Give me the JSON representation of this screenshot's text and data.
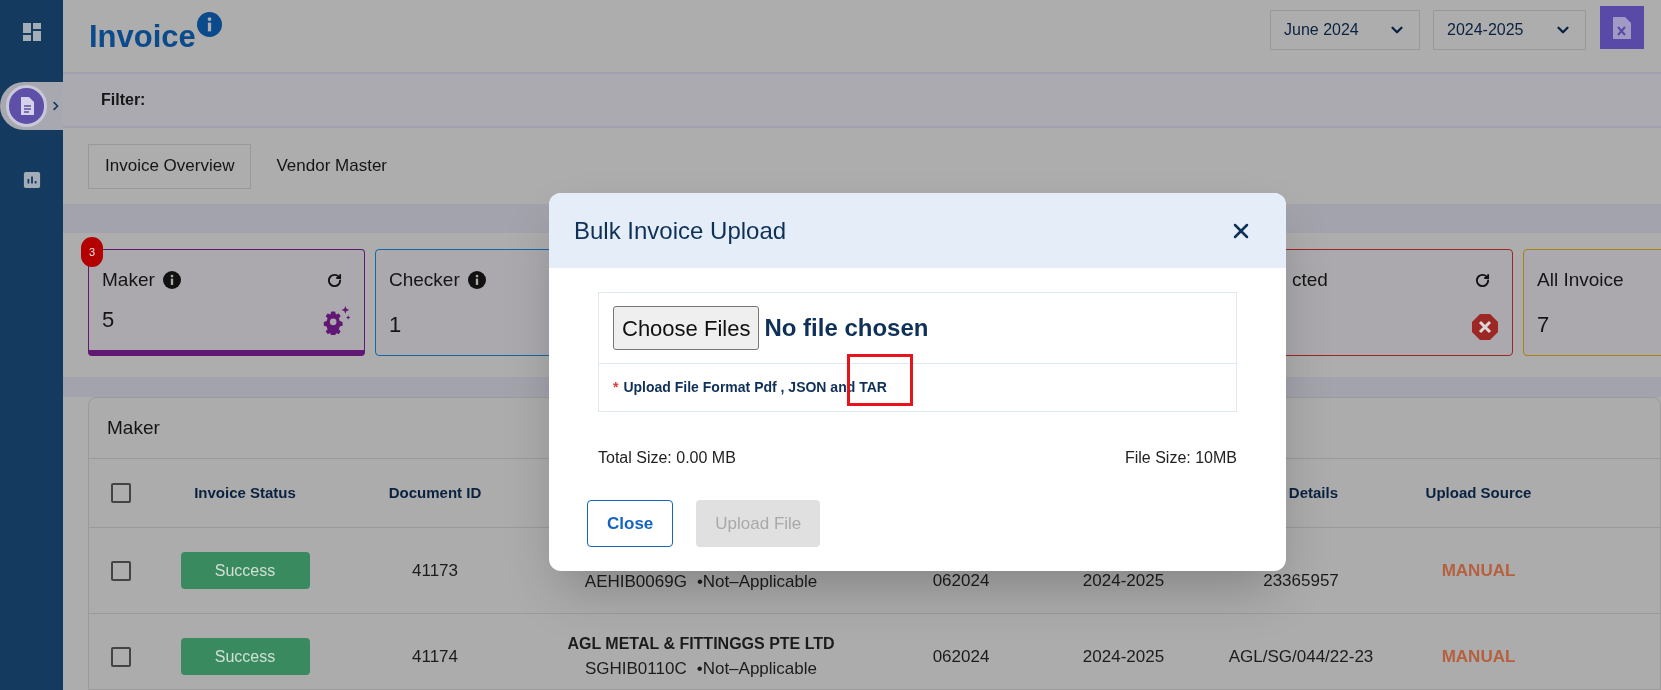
{
  "sidebar": {
    "items": [
      {
        "kind": "dashboard",
        "selected": false
      },
      {
        "kind": "document",
        "selected": true
      },
      {
        "kind": "chart",
        "selected": false
      }
    ]
  },
  "header": {
    "title": "Invoice",
    "selects": [
      "June 2024",
      "2024-2025"
    ]
  },
  "filter": {
    "label": "Filter:"
  },
  "tabs": [
    {
      "label": "Invoice Overview",
      "selected": true
    },
    {
      "label": "Vendor Master",
      "selected": false
    }
  ],
  "cards": {
    "left": [
      {
        "kind": "gear",
        "label": "Maker",
        "value": "5",
        "color": "#611874",
        "selected": true,
        "badge": "3",
        "info": true,
        "refresh": true,
        "clipped": false
      },
      {
        "kind": "plain",
        "label": "Checker",
        "value": "1",
        "color": "#1666a5",
        "selected": false,
        "info": true,
        "refresh": false,
        "clipped": false
      }
    ],
    "right": [
      {
        "kind": "error",
        "label": "cted",
        "color": "#9c2724",
        "selected": false,
        "info": false,
        "refresh": true,
        "clipped": true
      },
      {
        "kind": "plain",
        "label": "All Invoice",
        "value": "7",
        "color": "#a58412",
        "selected": false,
        "info": false,
        "clipped": false
      }
    ]
  },
  "table": {
    "title": "Maker",
    "header_checked": false,
    "columns": {
      "invoice_status": "Invoice Status",
      "document_id": "Document ID",
      "details": "Details",
      "upload_source": "Upload Source"
    },
    "rows": [
      {
        "checked": false,
        "status": "Success",
        "document_id": "41173",
        "vendor_code": "AEHIB0069G",
        "vendor_note": "•Not–Applicable",
        "period": "062024",
        "year": "2024-2025",
        "details": "23365957",
        "upload_source": "MANUAL"
      },
      {
        "checked": false,
        "status": "Success",
        "document_id": "41174",
        "vendor_name": "AGL METAL & FITTINGGS PTE LTD",
        "vendor_code": "SGHIB0110C",
        "vendor_note": "•Not–Applicable",
        "period": "062024",
        "year": "2024-2025",
        "details": "AGL/SG/044/22-23",
        "upload_source": "MANUAL"
      }
    ]
  },
  "modal": {
    "title": "Bulk Invoice Upload",
    "choose_button": "Choose Files",
    "file_status": "No file chosen",
    "required_mark": "*",
    "format_note": "Upload File Format Pdf , JSON and TAR",
    "total_size": "Total Size: 0.00 MB",
    "file_size": "File Size: 10MB",
    "buttons": [
      {
        "label": "Close",
        "disabled": false
      },
      {
        "label": "Upload File",
        "disabled": true
      }
    ]
  }
}
